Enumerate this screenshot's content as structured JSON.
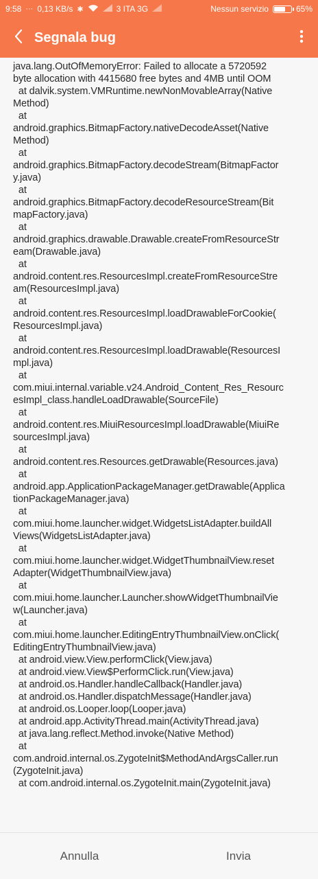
{
  "status_bar": {
    "time": "9:58",
    "speed": "0,13 KB/s",
    "carrier": "3 ITA 3G",
    "service": "Nessun servizio",
    "battery": "65%",
    "battery_level": 0.65
  },
  "app_bar": {
    "title": "Segnala bug"
  },
  "log_lines": [
    "java.lang.OutOfMemoryError: Failed to allocate a 5720592",
    "byte allocation with 4415680 free bytes and 4MB until OOM",
    "  at dalvik.system.VMRuntime.newNonMovableArray(Native",
    "Method)",
    "  at",
    "android.graphics.BitmapFactory.nativeDecodeAsset(Native",
    "Method)",
    "  at",
    "android.graphics.BitmapFactory.decodeStream(BitmapFactor",
    "y.java)",
    "  at",
    "android.graphics.BitmapFactory.decodeResourceStream(Bit",
    "mapFactory.java)",
    "  at",
    "android.graphics.drawable.Drawable.createFromResourceStr",
    "eam(Drawable.java)",
    "  at",
    "android.content.res.ResourcesImpl.createFromResourceStre",
    "am(ResourcesImpl.java)",
    "  at",
    "android.content.res.ResourcesImpl.loadDrawableForCookie(",
    "ResourcesImpl.java)",
    "  at",
    "android.content.res.ResourcesImpl.loadDrawable(ResourcesI",
    "mpl.java)",
    "  at",
    "com.miui.internal.variable.v24.Android_Content_Res_Resourc",
    "esImpl_class.handleLoadDrawable(SourceFile)",
    "  at",
    "android.content.res.MiuiResourcesImpl.loadDrawable(MiuiRe",
    "sourcesImpl.java)",
    "  at",
    "android.content.res.Resources.getDrawable(Resources.java)",
    "  at",
    "android.app.ApplicationPackageManager.getDrawable(Applica",
    "tionPackageManager.java)",
    "  at",
    "com.miui.home.launcher.widget.WidgetsListAdapter.buildAll",
    "Views(WidgetsListAdapter.java)",
    "  at",
    "com.miui.home.launcher.widget.WidgetThumbnailView.reset",
    "Adapter(WidgetThumbnailView.java)",
    "  at",
    "com.miui.home.launcher.Launcher.showWidgetThumbnailVie",
    "w(Launcher.java)",
    "  at",
    "com.miui.home.launcher.EditingEntryThumbnailView.onClick(",
    "EditingEntryThumbnailView.java)",
    "  at android.view.View.performClick(View.java)",
    "  at android.view.View$PerformClick.run(View.java)",
    "  at android.os.Handler.handleCallback(Handler.java)",
    "  at android.os.Handler.dispatchMessage(Handler.java)",
    "  at android.os.Looper.loop(Looper.java)",
    "  at android.app.ActivityThread.main(ActivityThread.java)",
    "  at java.lang.reflect.Method.invoke(Native Method)",
    "  at",
    "com.android.internal.os.ZygoteInit$MethodAndArgsCaller.run",
    "(ZygoteInit.java)",
    "  at com.android.internal.os.ZygoteInit.main(ZygoteInit.java)"
  ],
  "bottom_bar": {
    "cancel_label": "Annulla",
    "send_label": "Invia"
  },
  "colors": {
    "accent": "#f5774a",
    "background": "#f7f7f7",
    "text": "#2a2a2a"
  },
  "icons": {
    "back": "back-arrow-icon",
    "menu": "more-vert-icon"
  }
}
